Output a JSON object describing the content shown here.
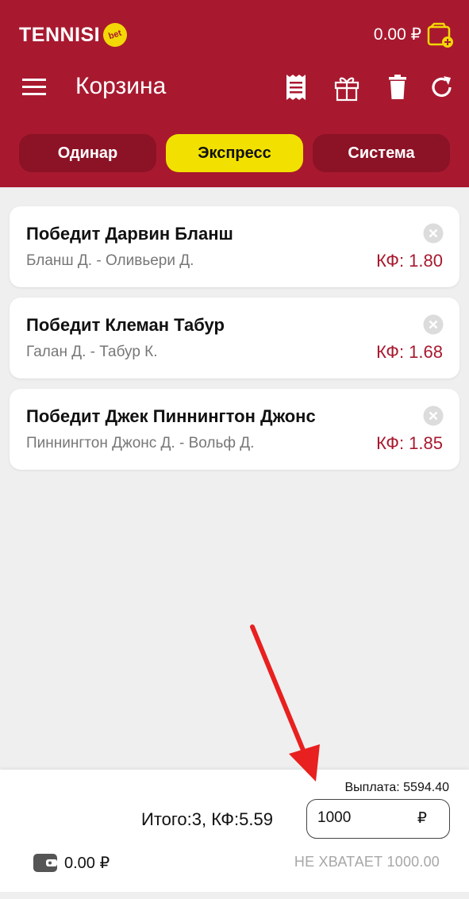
{
  "header": {
    "brand": "TENNISI",
    "brand_badge": "bet",
    "balance": "0.00 ₽",
    "title": "Корзина",
    "accent_color": "#a8192f"
  },
  "tabs": [
    {
      "label": "Одинар",
      "active": false
    },
    {
      "label": "Экспресс",
      "active": true
    },
    {
      "label": "Система",
      "active": false
    }
  ],
  "bets": [
    {
      "title": "Победит Дарвин Бланш",
      "match": "Бланш Д. - Оливьери Д.",
      "coef": "КФ: 1.80"
    },
    {
      "title": "Победит Клеман Табур",
      "match": "Галан Д. - Табур К.",
      "coef": "КФ: 1.68"
    },
    {
      "title": "Победит Джек Пиннингтон Джонс",
      "match": "Пиннингтон Джонс Д. - Вольф Д.",
      "coef": "КФ: 1.85"
    }
  ],
  "footer": {
    "payout": "Выплата: 5594.40",
    "summary": "Итого:3, КФ:5.59",
    "stake_value": "1000",
    "stake_currency": "₽",
    "wallet_balance": "0.00 ₽",
    "shortage": "НЕ ХВАТАЕТ 1000.00"
  }
}
